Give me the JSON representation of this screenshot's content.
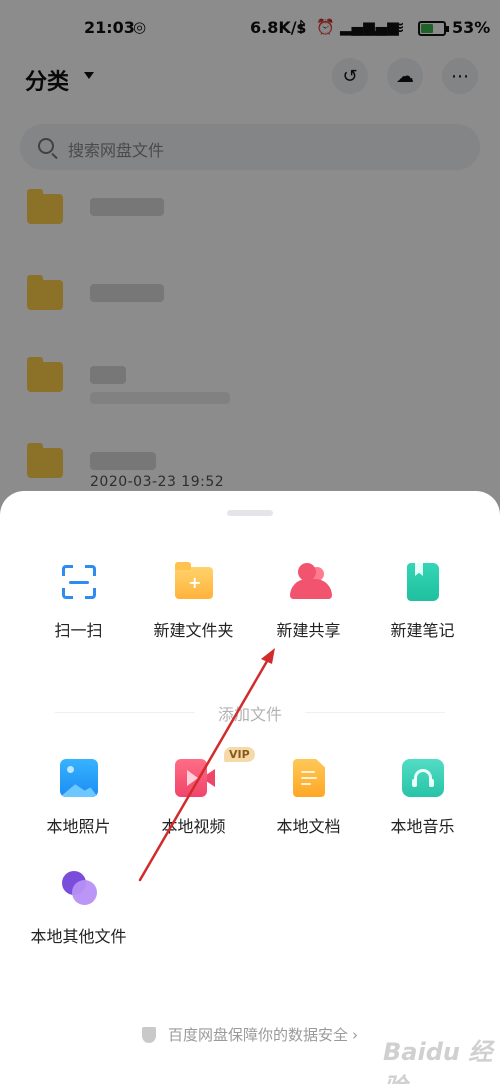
{
  "status_bar": {
    "time": "21:03",
    "network_speed": "6.8K/s",
    "battery_percent": "53",
    "battery_unit": "%",
    "battery_level": 0.53
  },
  "header": {
    "title": "分类"
  },
  "search": {
    "placeholder": "搜索网盘文件"
  },
  "file_list": {
    "last_item_date": "2020-03-23  19:52"
  },
  "sheet": {
    "actions": [
      {
        "label": "扫一扫",
        "icon": "scan-icon"
      },
      {
        "label": "新建文件夹",
        "icon": "new-folder-icon"
      },
      {
        "label": "新建共享",
        "icon": "share-icon"
      },
      {
        "label": "新建笔记",
        "icon": "note-icon"
      }
    ],
    "section_title": "添加文件",
    "add_files": [
      {
        "label": "本地照片",
        "icon": "photo-icon"
      },
      {
        "label": "本地视频",
        "icon": "video-icon",
        "badge": "VIP"
      },
      {
        "label": "本地文档",
        "icon": "document-icon"
      },
      {
        "label": "本地音乐",
        "icon": "music-icon"
      },
      {
        "label": "本地其他文件",
        "icon": "other-files-icon"
      }
    ],
    "footer": "百度网盘保障你的数据安全"
  },
  "watermark": "Baidu 经验",
  "colors": {
    "annotation_arrow": "#d22b2b",
    "scan_blue": "#2d8cf0",
    "folder_yellow": "#ffb23c",
    "share_pink": "#f2546f",
    "note_green": "#1fbf9f"
  }
}
